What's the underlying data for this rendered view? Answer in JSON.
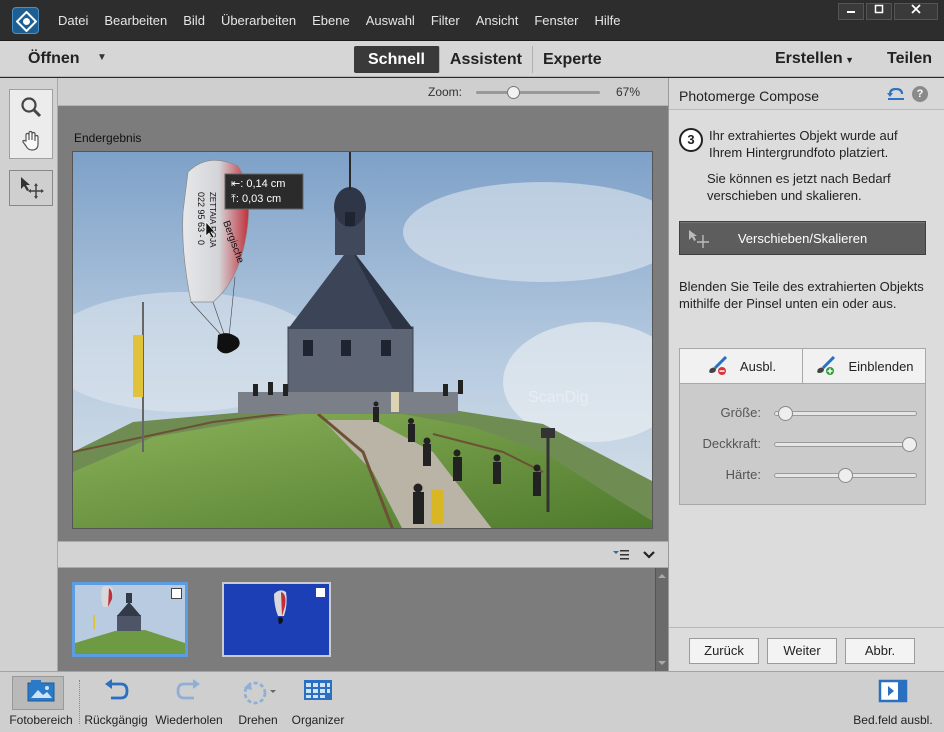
{
  "menubar": {
    "items": [
      "Datei",
      "Bearbeiten",
      "Bild",
      "Überarbeiten",
      "Ebene",
      "Auswahl",
      "Filter",
      "Ansicht",
      "Fenster",
      "Hilfe"
    ]
  },
  "modebar": {
    "open_label": "Öffnen",
    "tabs": [
      "Schnell",
      "Assistent",
      "Experte"
    ],
    "active_tab": "Schnell",
    "create_label": "Erstellen",
    "share_label": "Teilen"
  },
  "zoom": {
    "label": "Zoom:",
    "value": "67%",
    "fraction": 0.28
  },
  "canvas": {
    "label": "Endergebnis",
    "measure_x": "⇤: 0,14 cm",
    "measure_y": "⤒: 0,03 cm",
    "watermark": "ScanDig"
  },
  "panel": {
    "title": "Photomerge Compose",
    "step_number": "3",
    "step_text": "Ihr extrahiertes Objekt wurde auf Ihrem Hintergrundfoto platziert.",
    "step_subtext": "Sie können es jetzt nach Bedarf verschieben und skalieren.",
    "move_scale_label": "Verschieben/Skalieren",
    "brush_text": "Blenden Sie Teile des extrahierten Objekts mithilfe der Pinsel unten ein oder aus.",
    "hide_label": "Ausbl.",
    "show_label": "Einblenden",
    "sliders": [
      {
        "label": "Größe:",
        "fraction": 0.03
      },
      {
        "label": "Deckkraft:",
        "fraction": 1.0
      },
      {
        "label": "Härte:",
        "fraction": 0.5
      }
    ],
    "back_label": "Zurück",
    "next_label": "Weiter",
    "cancel_label": "Abbr."
  },
  "taskbar": {
    "photo_bin_label": "Fotobereich",
    "undo_label": "Rückgängig",
    "redo_label": "Wiederholen",
    "rotate_label": "Drehen",
    "organizer_label": "Organizer",
    "panel_toggle_label": "Bed.feld ausbl."
  },
  "colors": {
    "accent_blue": "#1d5f93",
    "selected_thumb": "#5b9de0",
    "button_dark": "#5d5d5d"
  }
}
